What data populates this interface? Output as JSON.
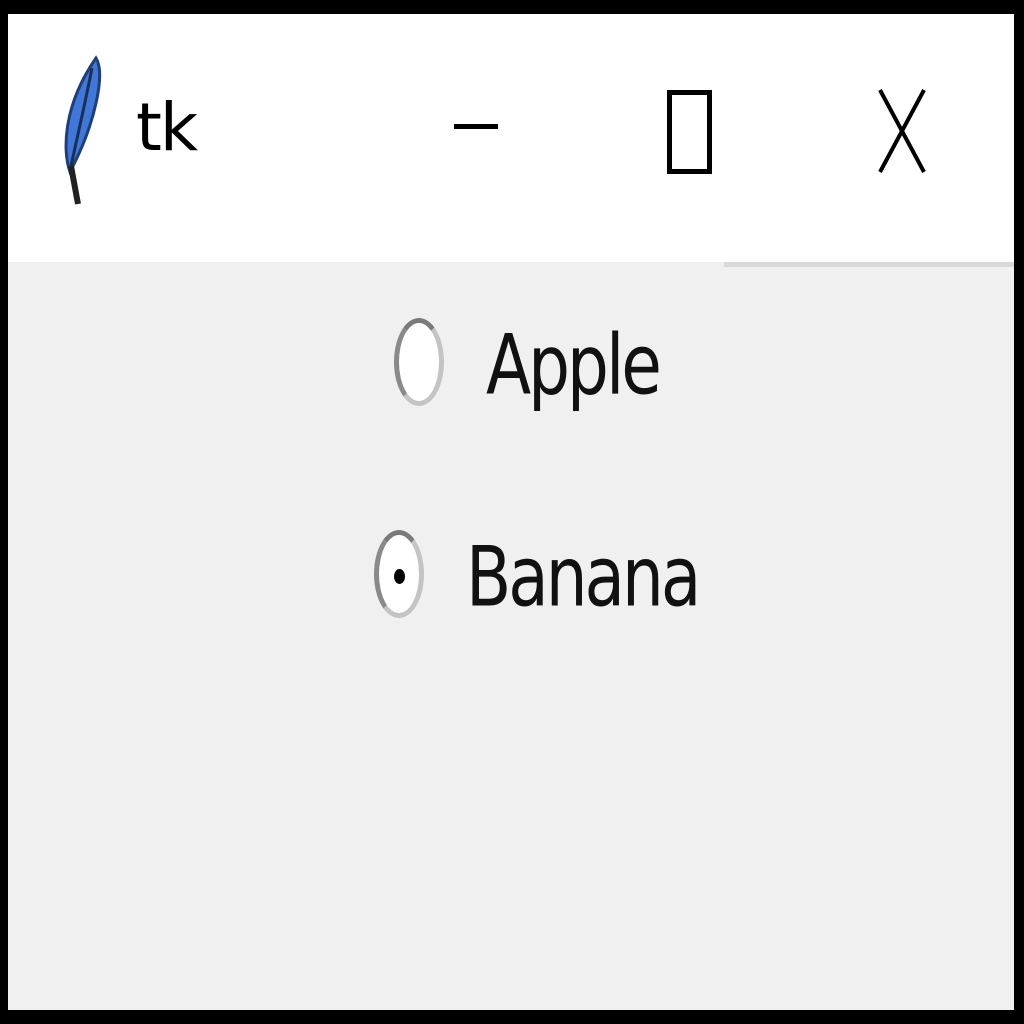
{
  "window": {
    "title": "tk",
    "app_icon": "tk-feather-icon",
    "controls": {
      "minimize_icon": "minimize-icon",
      "maximize_icon": "maximize-icon",
      "close_icon": "close-icon"
    }
  },
  "radio_group": {
    "options": [
      {
        "label": "Apple",
        "selected": false
      },
      {
        "label": "Banana",
        "selected": true
      }
    ]
  },
  "colors": {
    "window_bg": "#f0f0f0",
    "titlebar_bg": "#ffffff",
    "frame": "#000000",
    "feather_blue": "#3f78d8"
  }
}
